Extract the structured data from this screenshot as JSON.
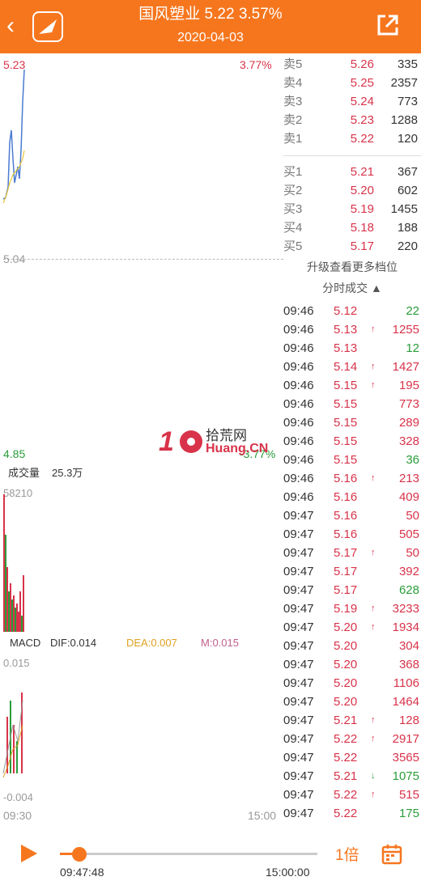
{
  "header": {
    "title": "国风塑业  5.22  3.57%",
    "date": "2020-04-03"
  },
  "chart": {
    "price_high": "5.23",
    "pct_high": "3.77%",
    "mid_price": "5.04",
    "price_low": "4.85",
    "pct_low": "-3.77%",
    "volume_label": "成交量",
    "volume_value": "25.3万",
    "volume_max": "58210",
    "macd_label": "MACD",
    "dif": "DIF:0.014",
    "dea": "DEA:0.007",
    "m": "M:0.015",
    "macd_high": "0.015",
    "macd_low": "-0.004",
    "time_start": "09:30",
    "time_end": "15:00",
    "colors": {
      "line": "#4a7bd0",
      "avg": "#e8c53a",
      "up": "#d8334a",
      "down": "#2a9d3a"
    }
  },
  "book": {
    "sells": [
      {
        "label": "卖5",
        "price": "5.26",
        "vol": "335"
      },
      {
        "label": "卖4",
        "price": "5.25",
        "vol": "2357"
      },
      {
        "label": "卖3",
        "price": "5.24",
        "vol": "773"
      },
      {
        "label": "卖2",
        "price": "5.23",
        "vol": "1288"
      },
      {
        "label": "卖1",
        "price": "5.22",
        "vol": "120"
      }
    ],
    "buys": [
      {
        "label": "买1",
        "price": "5.21",
        "vol": "367"
      },
      {
        "label": "买2",
        "price": "5.20",
        "vol": "602"
      },
      {
        "label": "买3",
        "price": "5.19",
        "vol": "1455"
      },
      {
        "label": "买4",
        "price": "5.18",
        "vol": "188"
      },
      {
        "label": "买5",
        "price": "5.17",
        "vol": "220"
      }
    ],
    "more_label": "升级查看更多档位",
    "fenshi_label": "分时成交 ▲"
  },
  "trades": [
    {
      "time": "09:46",
      "price": "5.12",
      "arrow": "",
      "vol": "22",
      "color": "green"
    },
    {
      "time": "09:46",
      "price": "5.13",
      "arrow": "↑",
      "vol": "1255",
      "color": "red"
    },
    {
      "time": "09:46",
      "price": "5.13",
      "arrow": "",
      "vol": "12",
      "color": "green"
    },
    {
      "time": "09:46",
      "price": "5.14",
      "arrow": "↑",
      "vol": "1427",
      "color": "red"
    },
    {
      "time": "09:46",
      "price": "5.15",
      "arrow": "↑",
      "vol": "195",
      "color": "red"
    },
    {
      "time": "09:46",
      "price": "5.15",
      "arrow": "",
      "vol": "773",
      "color": "red"
    },
    {
      "time": "09:46",
      "price": "5.15",
      "arrow": "",
      "vol": "289",
      "color": "red"
    },
    {
      "time": "09:46",
      "price": "5.15",
      "arrow": "",
      "vol": "328",
      "color": "red"
    },
    {
      "time": "09:46",
      "price": "5.15",
      "arrow": "",
      "vol": "36",
      "color": "green"
    },
    {
      "time": "09:46",
      "price": "5.16",
      "arrow": "↑",
      "vol": "213",
      "color": "red"
    },
    {
      "time": "09:46",
      "price": "5.16",
      "arrow": "",
      "vol": "409",
      "color": "red"
    },
    {
      "time": "09:47",
      "price": "5.16",
      "arrow": "",
      "vol": "50",
      "color": "red"
    },
    {
      "time": "09:47",
      "price": "5.16",
      "arrow": "",
      "vol": "505",
      "color": "red"
    },
    {
      "time": "09:47",
      "price": "5.17",
      "arrow": "↑",
      "vol": "50",
      "color": "red"
    },
    {
      "time": "09:47",
      "price": "5.17",
      "arrow": "",
      "vol": "392",
      "color": "red"
    },
    {
      "time": "09:47",
      "price": "5.17",
      "arrow": "",
      "vol": "628",
      "color": "green"
    },
    {
      "time": "09:47",
      "price": "5.19",
      "arrow": "↑",
      "vol": "3233",
      "color": "red"
    },
    {
      "time": "09:47",
      "price": "5.20",
      "arrow": "↑",
      "vol": "1934",
      "color": "red"
    },
    {
      "time": "09:47",
      "price": "5.20",
      "arrow": "",
      "vol": "304",
      "color": "red"
    },
    {
      "time": "09:47",
      "price": "5.20",
      "arrow": "",
      "vol": "368",
      "color": "red"
    },
    {
      "time": "09:47",
      "price": "5.20",
      "arrow": "",
      "vol": "1106",
      "color": "red"
    },
    {
      "time": "09:47",
      "price": "5.20",
      "arrow": "",
      "vol": "1464",
      "color": "red"
    },
    {
      "time": "09:47",
      "price": "5.21",
      "arrow": "↑",
      "vol": "128",
      "color": "red"
    },
    {
      "time": "09:47",
      "price": "5.22",
      "arrow": "↑",
      "vol": "2917",
      "color": "red"
    },
    {
      "time": "09:47",
      "price": "5.22",
      "arrow": "",
      "vol": "3565",
      "color": "red"
    },
    {
      "time": "09:47",
      "price": "5.21",
      "arrow": "↓",
      "vol": "1075",
      "color": "green"
    },
    {
      "time": "09:47",
      "price": "5.22",
      "arrow": "↑",
      "vol": "515",
      "color": "red"
    },
    {
      "time": "09:47",
      "price": "5.22",
      "arrow": "",
      "vol": "175",
      "color": "green"
    }
  ],
  "watermark": {
    "cn": "拾荒网",
    "en": "Huang.CN"
  },
  "player": {
    "current_time": "09:47:48",
    "end_time": "15:00:00",
    "progress": 0.077,
    "speed": "1倍"
  }
}
